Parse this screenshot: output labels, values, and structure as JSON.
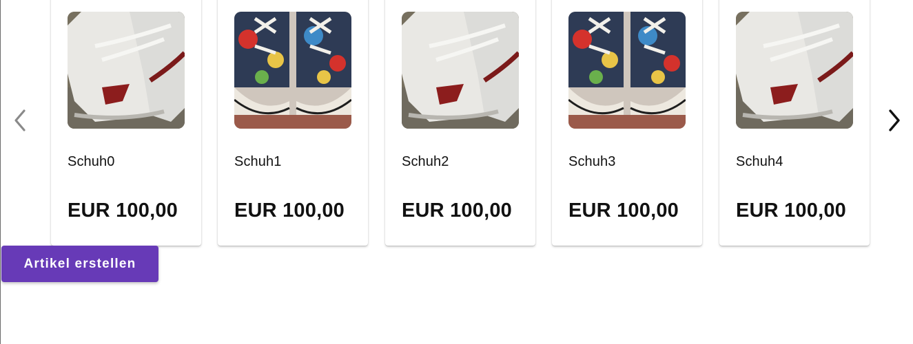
{
  "carousel": {
    "prev_icon": "chevron-left-icon",
    "next_icon": "chevron-right-icon",
    "items": [
      {
        "title": "Schuh0",
        "price": "EUR 100,00",
        "image": "white-high-top-sneakers"
      },
      {
        "title": "Schuh1",
        "price": "EUR 100,00",
        "image": "comic-print-sneakers"
      },
      {
        "title": "Schuh2",
        "price": "EUR 100,00",
        "image": "white-high-top-sneakers"
      },
      {
        "title": "Schuh3",
        "price": "EUR 100,00",
        "image": "comic-print-sneakers"
      },
      {
        "title": "Schuh4",
        "price": "EUR 100,00",
        "image": "white-high-top-sneakers"
      }
    ]
  },
  "actions": {
    "create_label": "Artikel erstellen"
  },
  "colors": {
    "primary": "#673ab7",
    "arrow_disabled": "#8a8a8a",
    "arrow_active": "#111111"
  }
}
